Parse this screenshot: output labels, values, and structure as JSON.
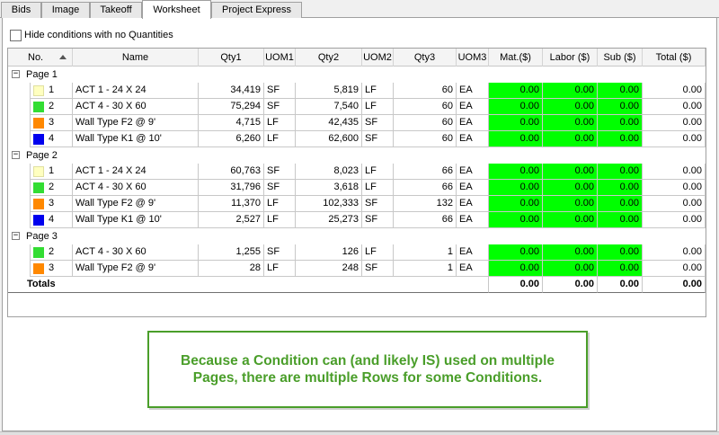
{
  "tabs": [
    {
      "label": "Bids",
      "active": false
    },
    {
      "label": "Image",
      "active": false
    },
    {
      "label": "Takeoff",
      "active": false
    },
    {
      "label": "Worksheet",
      "active": true
    },
    {
      "label": "Project Express",
      "active": false
    }
  ],
  "hide_conditions": {
    "label": "Hide conditions with no Quantities",
    "checked": false
  },
  "columns": [
    "No.",
    "Name",
    "Qty1",
    "UOM1",
    "Qty2",
    "UOM2",
    "Qty3",
    "UOM3",
    "Mat.($)",
    "Labor ($)",
    "Sub ($)",
    "Total ($)"
  ],
  "groups": [
    {
      "label": "Page 1",
      "rows": [
        {
          "no": "1",
          "name": "ACT 1 - 24 X 24",
          "color": "#ffffc0",
          "qty1": "34,419",
          "uom1": "SF",
          "qty2": "5,819",
          "uom2": "LF",
          "qty3": "60",
          "uom3": "EA",
          "mat": "0.00",
          "labor": "0.00",
          "sub": "0.00",
          "total": "0.00"
        },
        {
          "no": "2",
          "name": "ACT 4 - 30 X 60",
          "color": "#33dd33",
          "qty1": "75,294",
          "uom1": "SF",
          "qty2": "7,540",
          "uom2": "LF",
          "qty3": "60",
          "uom3": "EA",
          "mat": "0.00",
          "labor": "0.00",
          "sub": "0.00",
          "total": "0.00"
        },
        {
          "no": "3",
          "name": "Wall Type F2 @ 9'",
          "color": "#ff8800",
          "qty1": "4,715",
          "uom1": "LF",
          "qty2": "42,435",
          "uom2": "SF",
          "qty3": "60",
          "uom3": "EA",
          "mat": "0.00",
          "labor": "0.00",
          "sub": "0.00",
          "total": "0.00"
        },
        {
          "no": "4",
          "name": "Wall Type K1 @ 10'",
          "color": "#0000ee",
          "qty1": "6,260",
          "uom1": "LF",
          "qty2": "62,600",
          "uom2": "SF",
          "qty3": "60",
          "uom3": "EA",
          "mat": "0.00",
          "labor": "0.00",
          "sub": "0.00",
          "total": "0.00"
        }
      ]
    },
    {
      "label": "Page 2",
      "rows": [
        {
          "no": "1",
          "name": "ACT 1 - 24 X 24",
          "color": "#ffffc0",
          "qty1": "60,763",
          "uom1": "SF",
          "qty2": "8,023",
          "uom2": "LF",
          "qty3": "66",
          "uom3": "EA",
          "mat": "0.00",
          "labor": "0.00",
          "sub": "0.00",
          "total": "0.00"
        },
        {
          "no": "2",
          "name": "ACT 4 - 30 X 60",
          "color": "#33dd33",
          "qty1": "31,796",
          "uom1": "SF",
          "qty2": "3,618",
          "uom2": "LF",
          "qty3": "66",
          "uom3": "EA",
          "mat": "0.00",
          "labor": "0.00",
          "sub": "0.00",
          "total": "0.00"
        },
        {
          "no": "3",
          "name": "Wall Type F2 @ 9'",
          "color": "#ff8800",
          "qty1": "11,370",
          "uom1": "LF",
          "qty2": "102,333",
          "uom2": "SF",
          "qty3": "132",
          "uom3": "EA",
          "mat": "0.00",
          "labor": "0.00",
          "sub": "0.00",
          "total": "0.00"
        },
        {
          "no": "4",
          "name": "Wall Type K1 @ 10'",
          "color": "#0000ee",
          "qty1": "2,527",
          "uom1": "LF",
          "qty2": "25,273",
          "uom2": "SF",
          "qty3": "66",
          "uom3": "EA",
          "mat": "0.00",
          "labor": "0.00",
          "sub": "0.00",
          "total": "0.00"
        }
      ]
    },
    {
      "label": "Page 3",
      "rows": [
        {
          "no": "2",
          "name": "ACT 4 - 30 X 60",
          "color": "#33dd33",
          "qty1": "1,255",
          "uom1": "SF",
          "qty2": "126",
          "uom2": "LF",
          "qty3": "1",
          "uom3": "EA",
          "mat": "0.00",
          "labor": "0.00",
          "sub": "0.00",
          "total": "0.00"
        },
        {
          "no": "3",
          "name": "Wall Type F2 @ 9'",
          "color": "#ff8800",
          "qty1": "28",
          "uom1": "LF",
          "qty2": "248",
          "uom2": "SF",
          "qty3": "1",
          "uom3": "EA",
          "mat": "0.00",
          "labor": "0.00",
          "sub": "0.00",
          "total": "0.00"
        }
      ]
    }
  ],
  "totals": {
    "label": "Totals",
    "mat": "0.00",
    "labor": "0.00",
    "sub": "0.00",
    "total": "0.00"
  },
  "callout": {
    "text": "Because a Condition can (and likely IS) used on multiple Pages, there are multiple Rows for some Conditions."
  },
  "colors": {
    "highlight_green": "#00ff00",
    "callout_green": "#4a9e2a"
  }
}
